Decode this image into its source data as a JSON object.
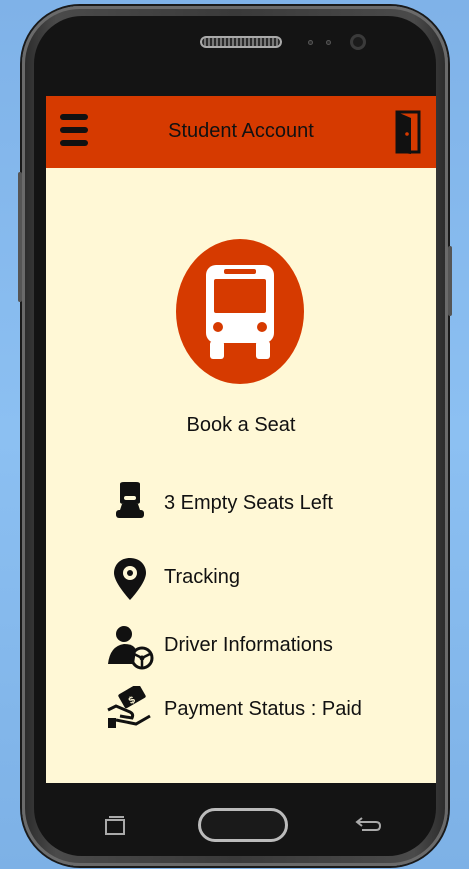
{
  "header": {
    "title": "Student Account",
    "menu_icon": "hamburger-menu-icon",
    "logout_icon": "door-exit-icon"
  },
  "main": {
    "book_label": "Book a Seat",
    "bus_icon": "bus-icon"
  },
  "items": [
    {
      "label": "3 Empty Seats Left",
      "icon": "seat-icon"
    },
    {
      "label": "Tracking",
      "icon": "location-pin-icon"
    },
    {
      "label": "Driver Informations",
      "icon": "driver-icon"
    },
    {
      "label": "Payment Status : Paid",
      "icon": "payment-icon"
    }
  ],
  "colors": {
    "accent": "#d63a00",
    "screen_bg": "#fff8d6",
    "text": "#111111"
  }
}
